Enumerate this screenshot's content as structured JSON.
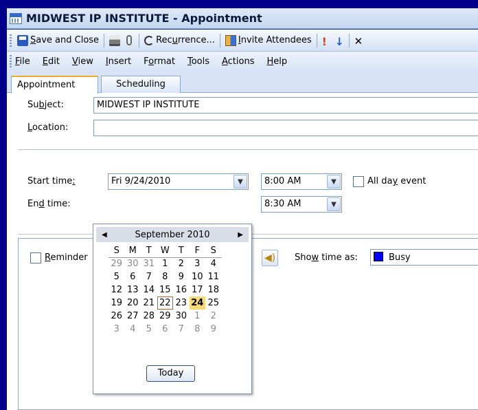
{
  "window": {
    "title": "MIDWEST IP INSTITUTE - Appointment"
  },
  "toolbar": {
    "save_close": {
      "pre": "",
      "ul": "S",
      "post": "ave and Close"
    },
    "recurrence": {
      "pre": "Rec",
      "ul": "u",
      "post": "rrence..."
    },
    "invite": {
      "pre": "",
      "ul": "I",
      "post": "nvite Attendees"
    }
  },
  "menubar": [
    {
      "pre": "",
      "ul": "F",
      "post": "ile"
    },
    {
      "pre": "",
      "ul": "E",
      "post": "dit"
    },
    {
      "pre": "",
      "ul": "V",
      "post": "iew"
    },
    {
      "pre": "",
      "ul": "I",
      "post": "nsert"
    },
    {
      "pre": "F",
      "ul": "o",
      "post": "rmat"
    },
    {
      "pre": "",
      "ul": "T",
      "post": "ools"
    },
    {
      "pre": "",
      "ul": "A",
      "post": "ctions"
    },
    {
      "pre": "",
      "ul": "H",
      "post": "elp"
    }
  ],
  "tabs": [
    {
      "label": "Appointment"
    },
    {
      "label": "Scheduling"
    }
  ],
  "form": {
    "subject_label": {
      "pre": "Su",
      "ul": "b",
      "post": "ject:"
    },
    "subject_value": "MIDWEST IP INSTITUTE",
    "location_label": {
      "pre": "",
      "ul": "L",
      "post": "ocation:"
    },
    "location_value": "",
    "start_label": {
      "pre": "Start time",
      "ul": ":",
      "post": ""
    },
    "start_date": "Fri 9/24/2010",
    "start_time": "8:00 AM",
    "allday_label": {
      "pre": "All da",
      "ul": "y",
      "post": " event"
    },
    "end_label": {
      "pre": "En",
      "ul": "d",
      "post": " time:"
    },
    "end_time": "8:30 AM",
    "reminder_label": {
      "pre": "",
      "ul": "R",
      "post": "eminder"
    },
    "showas_label": {
      "pre": "Sho",
      "ul": "w",
      "post": " time as:"
    },
    "showas_value": "Busy"
  },
  "calendar": {
    "month": "September 2010",
    "weekdays": [
      "S",
      "M",
      "T",
      "W",
      "T",
      "F",
      "S"
    ],
    "weeks": [
      [
        {
          "d": "29",
          "dim": true
        },
        {
          "d": "30",
          "dim": true
        },
        {
          "d": "31",
          "dim": true
        },
        {
          "d": "1"
        },
        {
          "d": "2"
        },
        {
          "d": "3"
        },
        {
          "d": "4"
        }
      ],
      [
        {
          "d": "5"
        },
        {
          "d": "6"
        },
        {
          "d": "7"
        },
        {
          "d": "8"
        },
        {
          "d": "9"
        },
        {
          "d": "10"
        },
        {
          "d": "11"
        }
      ],
      [
        {
          "d": "12"
        },
        {
          "d": "13"
        },
        {
          "d": "14"
        },
        {
          "d": "15"
        },
        {
          "d": "16"
        },
        {
          "d": "17"
        },
        {
          "d": "18"
        }
      ],
      [
        {
          "d": "19"
        },
        {
          "d": "20"
        },
        {
          "d": "21"
        },
        {
          "d": "22",
          "today": true
        },
        {
          "d": "23"
        },
        {
          "d": "24",
          "selected": true
        },
        {
          "d": "25"
        }
      ],
      [
        {
          "d": "26"
        },
        {
          "d": "27"
        },
        {
          "d": "28"
        },
        {
          "d": "29"
        },
        {
          "d": "30"
        },
        {
          "d": "1",
          "dim": true
        },
        {
          "d": "2",
          "dim": true
        }
      ],
      [
        {
          "d": "3",
          "dim": true
        },
        {
          "d": "4",
          "dim": true
        },
        {
          "d": "5",
          "dim": true
        },
        {
          "d": "6",
          "dim": true
        },
        {
          "d": "7",
          "dim": true
        },
        {
          "d": "8",
          "dim": true
        },
        {
          "d": "9",
          "dim": true
        }
      ]
    ],
    "today_button": "Today"
  },
  "colors": {
    "busy": "#0000ff",
    "selected_day": "#f7d978",
    "desktop": "#00008b"
  }
}
